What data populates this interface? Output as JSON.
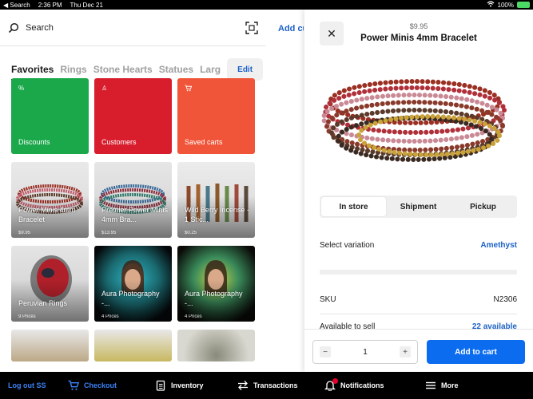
{
  "status_bar": {
    "back_label": "◀ Search",
    "time": "2:36 PM",
    "date": "Thu Dec 21",
    "battery": "100%"
  },
  "left": {
    "search_label": "Search",
    "tabs": [
      "Favorites",
      "Rings",
      "Stone Hearts",
      "Statues",
      "Larg"
    ],
    "edit_label": "Edit",
    "tiles": [
      {
        "title": "Discounts",
        "icon": "%",
        "color": "#1aa84a"
      },
      {
        "title": "Customers",
        "icon": "♙",
        "color": "#d81e2c"
      },
      {
        "title": "Saved carts",
        "icon": "🛒",
        "color": "#f0553a"
      },
      {
        "title": "Power Minis 4mm Bracelet",
        "sub": "$9.95"
      },
      {
        "title": "Premier Power Minis 4mm Bra...",
        "sub": "$13.95"
      },
      {
        "title": "Wild Berry Incense - 1 Stic...",
        "sub": "$0.25"
      },
      {
        "title": "Peruvian Rings",
        "sub": "9 Prices"
      },
      {
        "title": "Aura Photography -...",
        "sub": "4 Prices"
      },
      {
        "title": "Aura Photography -...",
        "sub": "4 Prices"
      }
    ]
  },
  "add_customer_label": "Add cu",
  "modal": {
    "price": "$9.95",
    "title": "Power Minis 4mm Bracelet",
    "segments": [
      "In store",
      "Shipment",
      "Pickup"
    ],
    "active_segment": 0,
    "variation_label": "Select variation",
    "variation_value": "Amethyst",
    "sku_label": "SKU",
    "sku_value": "N2306",
    "available_label": "Available to sell",
    "available_value": "22 available",
    "quantity": "1",
    "add_to_cart": "Add to cart"
  },
  "nav": {
    "logout": "Log out SS",
    "checkout": "Checkout",
    "inventory": "Inventory",
    "transactions": "Transactions",
    "notifications": "Notifications",
    "more": "More"
  },
  "colors": {
    "accent": "#0b6cf0",
    "link": "#1d62c7",
    "discounts": "#1aa84a",
    "customers": "#d81e2c",
    "saved_carts": "#f0553a"
  }
}
